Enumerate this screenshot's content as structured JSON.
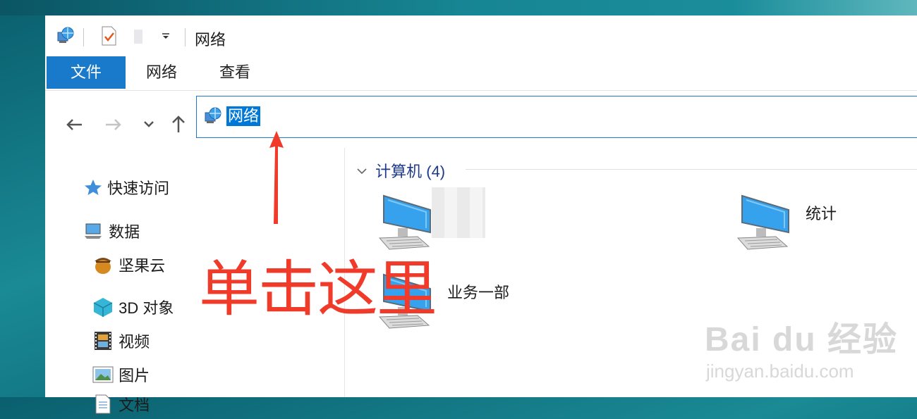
{
  "window": {
    "title": "网络"
  },
  "ribbon": {
    "tabs": [
      {
        "label": "文件"
      },
      {
        "label": "网络"
      },
      {
        "label": "查看"
      }
    ]
  },
  "address": {
    "path": "网络"
  },
  "sidebar": {
    "items": [
      {
        "label": "快速访问",
        "icon": "star-icon"
      },
      {
        "label": "数据",
        "icon": "computer-icon"
      },
      {
        "label": "坚果云",
        "icon": "acorn-icon"
      },
      {
        "label": "3D 对象",
        "icon": "cube-icon"
      },
      {
        "label": "视频",
        "icon": "film-icon"
      },
      {
        "label": "图片",
        "icon": "picture-icon"
      },
      {
        "label": "文档",
        "icon": "document-icon"
      }
    ]
  },
  "content": {
    "group": {
      "label": "计算机 (4)"
    },
    "computers": [
      {
        "label": ""
      },
      {
        "label": "统计"
      },
      {
        "label": "业务一部"
      }
    ]
  },
  "annotation": {
    "text": "单击这里",
    "color": "#f03a2a"
  },
  "watermark": {
    "main": "Bai du 经验",
    "sub": "jingyan.baidu.com"
  },
  "colors": {
    "accent": "#1979ca",
    "selection": "#0078d7"
  }
}
